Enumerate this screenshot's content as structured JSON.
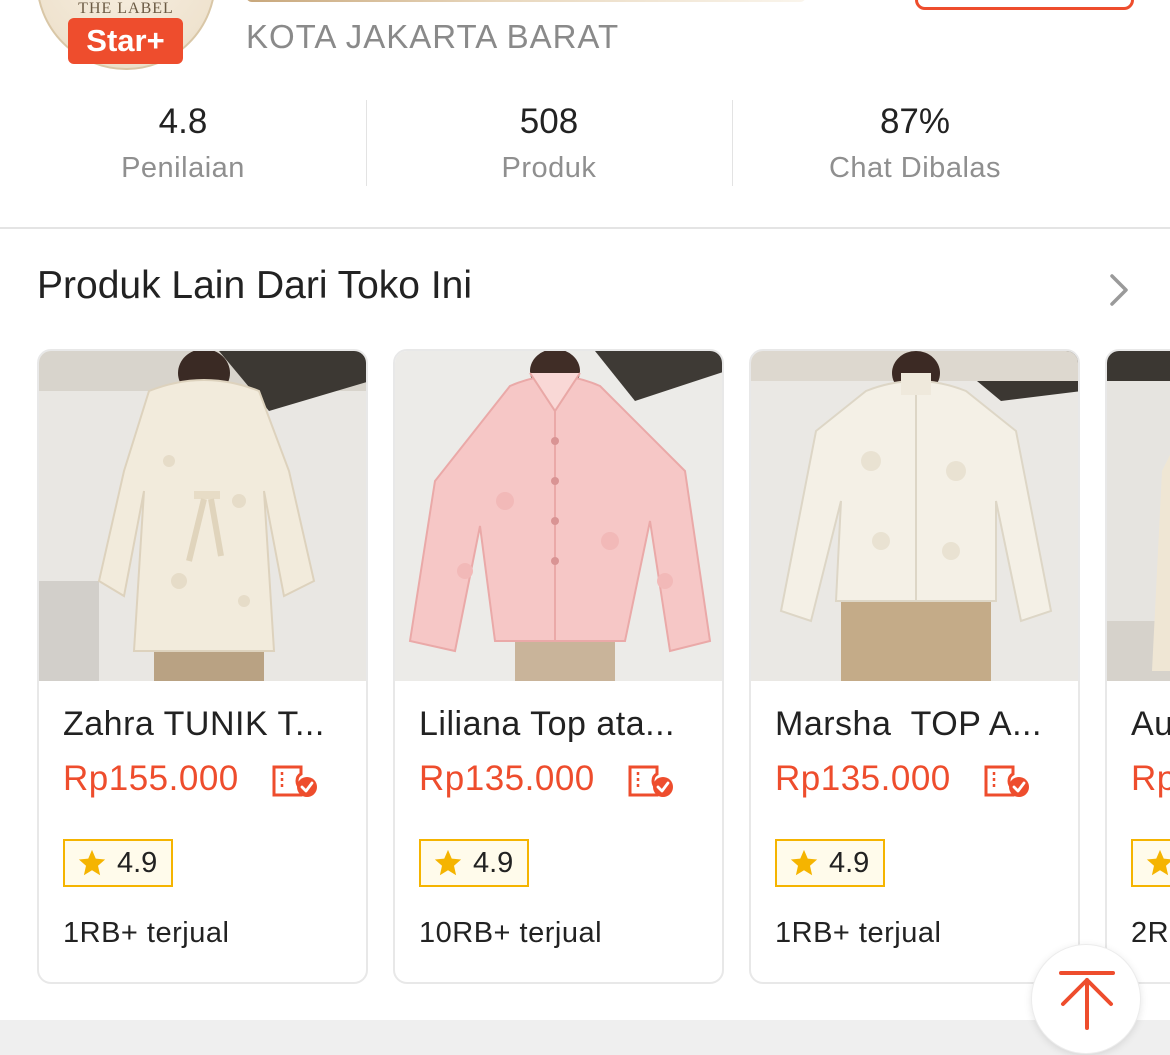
{
  "shop": {
    "logo_text": "THE LABEL",
    "badge": "Star+",
    "location": "KOTA JAKARTA BARAT"
  },
  "stats": [
    {
      "value": "4.8",
      "label": "Penilaian"
    },
    {
      "value": "508",
      "label": "Produk"
    },
    {
      "value": "87%",
      "label": "Chat Dibalas"
    }
  ],
  "section": {
    "title": "Produk Lain Dari Toko Ini",
    "more_icon": "chevron-right-icon"
  },
  "products": [
    {
      "title": "Zahra TUNIK T...",
      "price": "Rp155.000",
      "rating": "4.9",
      "sold": "1RB+ terjual",
      "color": "cream"
    },
    {
      "title": "Liliana Top ata...",
      "price": "Rp135.000",
      "rating": "4.9",
      "sold": "10RB+ terjual",
      "color": "pink"
    },
    {
      "title": "Marsha  TOP A...",
      "price": "Rp135.000",
      "rating": "4.9",
      "sold": "1RB+ terjual",
      "color": "ivory"
    },
    {
      "title": "Au",
      "price": "Rp",
      "rating": "",
      "sold": "2R",
      "color": "cream"
    }
  ],
  "colors": {
    "accent": "#ee4d2d",
    "rating_border": "#f5b400",
    "star": "#f5b400"
  },
  "icons": {
    "voucher": "voucher-check-icon",
    "star": "star-icon",
    "scroll_top": "arrow-up-icon"
  }
}
